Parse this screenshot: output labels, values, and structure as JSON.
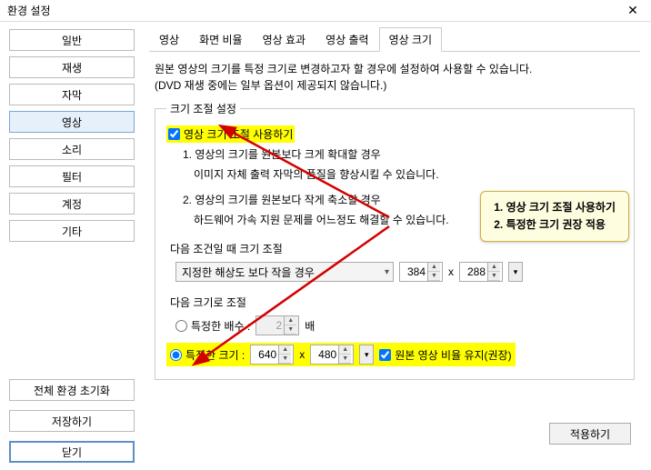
{
  "window": {
    "title": "환경 설정",
    "close": "✕"
  },
  "sidebar": {
    "items": [
      "일반",
      "재생",
      "자막",
      "영상",
      "소리",
      "필터",
      "계정",
      "기타"
    ],
    "selectedIndex": 3,
    "reset": "전체 환경 초기화",
    "save": "저장하기",
    "close": "닫기"
  },
  "tabs": {
    "items": [
      "영상",
      "화면 비율",
      "영상 효과",
      "영상 출력",
      "영상 크기"
    ],
    "activeIndex": 4
  },
  "desc": {
    "l1": "원본 영상의 크기를 특정 크기로 변경하고자 할 경우에 설정하여 사용할 수 있습니다.",
    "l2": "(DVD 재생 중에는 일부 옵션이 제공되지 않습니다.)"
  },
  "group": {
    "legend": "크기 조절 설정",
    "enable": "영상 크기 조절 사용하기",
    "case1a": "1. 영상의 크기를 원본보다 크게 확대할 경우",
    "case1b": "이미지 자체 출력 자막의 품질을 향상시킬 수 있습니다.",
    "case2a": "2. 영상의 크기를 원본보다 작게 축소할 경우",
    "case2b": "하드웨어 가속 지원 문제를 어느정도 해결할 수 있습니다.",
    "cond_label": "다음 조건일 때 크기 조절",
    "cond_select": "지정한 해상도 보다 작을 경우",
    "cond_w": "384",
    "cond_h": "288",
    "x": "x",
    "size_label": "다음 크기로 조절",
    "mult_label": "특정한 배수 :",
    "mult_val": "2",
    "mult_unit": "배",
    "fixed_label": "특정한 크기 :",
    "fixed_w": "640",
    "fixed_h": "480",
    "keep_ratio": "원본 영상 비율 유지(권장)"
  },
  "callout": {
    "l1": "1. 영상 크기 조절 사용하기",
    "l2": "2. 특정한 크기 권장 적용"
  },
  "apply": "적용하기"
}
